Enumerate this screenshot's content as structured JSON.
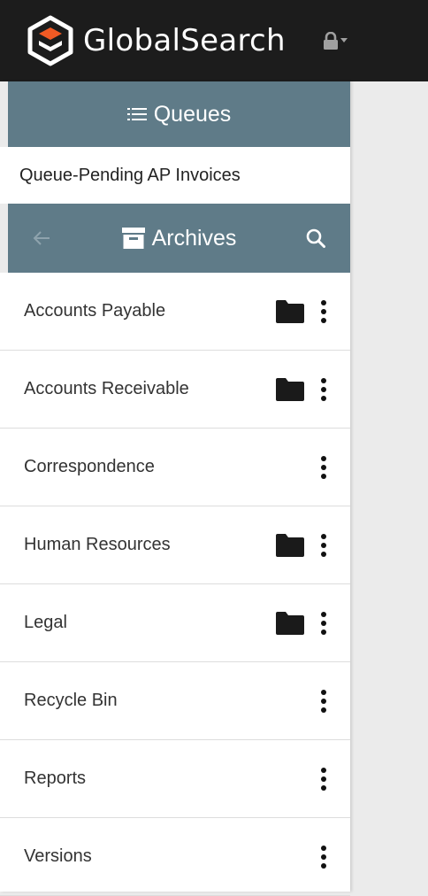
{
  "header": {
    "brand": "GlobalSearch",
    "logo_icon": "globalsearch-logo-icon",
    "lock_icon": "lock-icon",
    "caret_icon": "caret-down-icon",
    "background": "#1c1c1c"
  },
  "queues": {
    "title": "Queues",
    "icon": "list-icon",
    "items": [
      {
        "label": "Queue-Pending AP Invoices"
      }
    ]
  },
  "archives": {
    "title": "Archives",
    "icon": "archive-box-icon",
    "back_icon": "back-arrow-icon",
    "search_icon": "search-icon",
    "items": [
      {
        "label": "Accounts Payable",
        "has_folder": true
      },
      {
        "label": "Accounts Receivable",
        "has_folder": true
      },
      {
        "label": "Correspondence",
        "has_folder": false
      },
      {
        "label": "Human Resources",
        "has_folder": true
      },
      {
        "label": "Legal",
        "has_folder": true
      },
      {
        "label": "Recycle Bin",
        "has_folder": false
      },
      {
        "label": "Reports",
        "has_folder": false
      },
      {
        "label": "Versions",
        "has_folder": false
      }
    ]
  },
  "colors": {
    "section_header": "#5f7b88",
    "topbar": "#1c1c1c",
    "logo_accent": "#f15a24",
    "content_background": "#ebebeb"
  }
}
